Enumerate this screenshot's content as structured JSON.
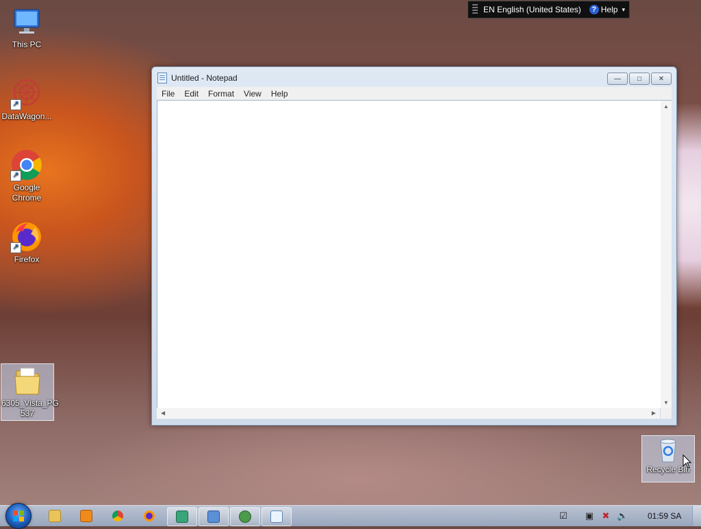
{
  "desktop": {
    "icons": [
      {
        "label": "This PC"
      },
      {
        "label": "DataWagon..."
      },
      {
        "label": "Google Chrome"
      },
      {
        "label": "Firefox"
      },
      {
        "label": "6305_Vista_PG 537"
      },
      {
        "label": "Recycle Bin"
      }
    ]
  },
  "langbar": {
    "language": "EN English (United States)",
    "help_label": "Help"
  },
  "notepad": {
    "title": "Untitled - Notepad",
    "menu": [
      "File",
      "Edit",
      "Format",
      "View",
      "Help"
    ],
    "content": ""
  },
  "taskbar": {
    "clock": "01:59 SA"
  },
  "colors": {
    "accent": "#1d5cb8",
    "titlebar": "#dfe9f4"
  }
}
